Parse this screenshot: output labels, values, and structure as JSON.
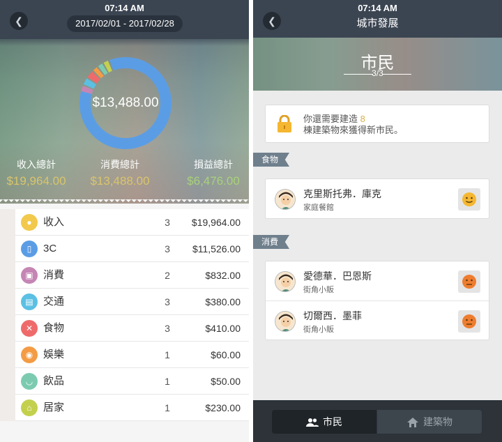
{
  "left": {
    "status_time": "07:14 AM",
    "date_range": "2017/02/01 - 2017/02/28",
    "donut_total": "$13,488.00",
    "donut_slices": [
      {
        "label": "消費",
        "value": 832,
        "color": "#c586b4"
      },
      {
        "label": "交通",
        "value": 380,
        "color": "#5bc0e3"
      },
      {
        "label": "食物",
        "value": 410,
        "color": "#ef6b6b"
      },
      {
        "label": "娛樂",
        "value": 60,
        "color": "#f39c45"
      },
      {
        "label": "飲品",
        "value": 50,
        "color": "#7ccbb1"
      },
      {
        "label": "居家",
        "value": 230,
        "color": "#c3d04e"
      },
      {
        "label": "3C",
        "value": 11526,
        "color": "#5b9de5"
      }
    ],
    "summary": {
      "income_label": "收入總計",
      "income_value": "$19,964.00",
      "income_color": "#d9c56b",
      "expense_label": "消費總計",
      "expense_value": "$13,488.00",
      "expense_color": "#d9c56b",
      "profit_label": "損益總計",
      "profit_value": "$6,476.00",
      "profit_color": "#a8d27a"
    },
    "rows": [
      {
        "name": "收入",
        "count": "3",
        "amount": "$19,964.00",
        "icon": "income-icon",
        "color": "#f2c94c"
      },
      {
        "name": "3C",
        "count": "3",
        "amount": "$11,526.00",
        "icon": "phone-icon",
        "color": "#5b9de5"
      },
      {
        "name": "消費",
        "count": "2",
        "amount": "$832.00",
        "icon": "shopping-bag-icon",
        "color": "#c586b4"
      },
      {
        "name": "交通",
        "count": "3",
        "amount": "$380.00",
        "icon": "bus-icon",
        "color": "#5bc0e3"
      },
      {
        "name": "食物",
        "count": "3",
        "amount": "$410.00",
        "icon": "fork-knife-icon",
        "color": "#ef6b6b"
      },
      {
        "name": "娛樂",
        "count": "1",
        "amount": "$60.00",
        "icon": "gamepad-icon",
        "color": "#f39c45"
      },
      {
        "name": "飲品",
        "count": "1",
        "amount": "$50.00",
        "icon": "cup-icon",
        "color": "#7ccbb1"
      },
      {
        "name": "居家",
        "count": "1",
        "amount": "$230.00",
        "icon": "house-icon",
        "color": "#c3d04e"
      }
    ]
  },
  "right": {
    "status_time": "07:14 AM",
    "title": "城市發展",
    "hero_title": "市民",
    "hero_sub": "3/3",
    "notice_line1": "你還需要建造",
    "notice_num": "8",
    "notice_line2": "棟建築物來獲得新市民。",
    "sections": [
      {
        "tag": "食物",
        "citizens": [
          {
            "name": "克里斯托弗．庫克",
            "job": "家庭餐館",
            "mood_color": "#f5b731"
          }
        ]
      },
      {
        "tag": "消費",
        "citizens": [
          {
            "name": "愛德華．巴恩斯",
            "job": "街角小販",
            "mood_color": "#ef7d2f"
          },
          {
            "name": "切爾西．墨菲",
            "job": "街角小販",
            "mood_color": "#ef7d2f"
          }
        ]
      }
    ],
    "tabs": {
      "citizens": "市民",
      "buildings": "建築物"
    }
  }
}
